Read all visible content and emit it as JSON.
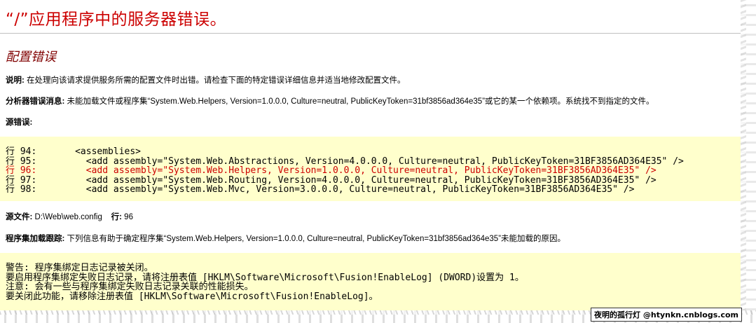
{
  "title": "“/”应用程序中的服务器错误。",
  "subtitle": "配置错误",
  "description": {
    "label": "说明:",
    "text": " 在处理向该请求提供服务所需的配置文件时出错。请检查下面的特定错误详细信息并适当地修改配置文件。"
  },
  "parser_error": {
    "label": "分析器错误消息:",
    "text": " 未能加载文件或程序集“System.Web.Helpers, Version=1.0.0.0, Culture=neutral, PublicKeyToken=31bf3856ad364e35”或它的某一个依赖项。系统找不到指定的文件。"
  },
  "source_error_label": "源错误:",
  "source_lines": [
    {
      "text": "行 94:       <assemblies>",
      "error": false
    },
    {
      "text": "行 95:         <add assembly=\"System.Web.Abstractions, Version=4.0.0.0, Culture=neutral, PublicKeyToken=31BF3856AD364E35\" />",
      "error": false
    },
    {
      "text": "行 96:         <add assembly=\"System.Web.Helpers, Version=1.0.0.0, Culture=neutral, PublicKeyToken=31BF3856AD364E35\" />",
      "error": true
    },
    {
      "text": "行 97:         <add assembly=\"System.Web.Routing, Version=4.0.0.0, Culture=neutral, PublicKeyToken=31BF3856AD364E35\" />",
      "error": false
    },
    {
      "text": "行 98:         <add assembly=\"System.Web.Mvc, Version=3.0.0.0, Culture=neutral, PublicKeyToken=31BF3856AD364E35\" />",
      "error": false
    }
  ],
  "source_file": {
    "label": "源文件:",
    "path": " D:\\Web\\web.config",
    "line_label": "行:",
    "line_value": " 96"
  },
  "assembly_trace": {
    "label": "程序集加载跟踪:",
    "text": " 下列信息有助于确定程序集“System.Web.Helpers, Version=1.0.0.0, Culture=neutral, PublicKeyToken=31bf3856ad364e35”未能加载的原因。"
  },
  "trace_lines": [
    "警告: 程序集绑定日志记录被关闭。",
    "要启用程序集绑定失败日志记录，请将注册表值 [HKLM\\Software\\Microsoft\\Fusion!EnableLog] (DWORD)设置为 1。",
    "注意: 会有一些与程序集绑定失败日志记录关联的性能损失。",
    "要关闭此功能，请移除注册表值 [HKLM\\Software\\Microsoft\\Fusion!EnableLog]。"
  ],
  "watermark": "夜明的孤行灯 @htynkn.cnblogs.com",
  "colors": {
    "title": "#cc0000",
    "subtitle": "#800000",
    "code_bg": "#ffffcc",
    "error_line": "#cc0000"
  }
}
